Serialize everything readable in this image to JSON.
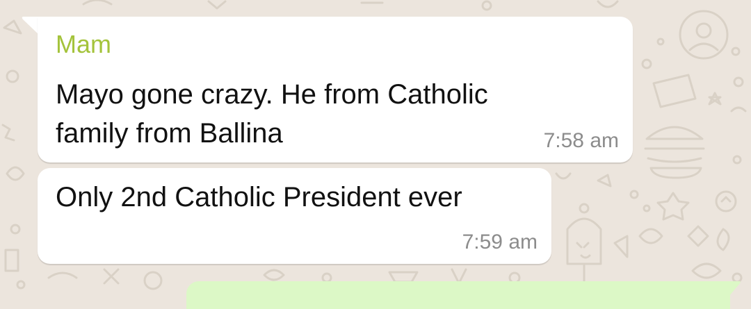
{
  "chat": {
    "messages": [
      {
        "sender": "Mam",
        "text": "Mayo gone crazy. He from Catholic\nfamily from Ballina",
        "time": "7:58 am"
      },
      {
        "text": "Only 2nd Catholic President ever",
        "time": "7:59 am"
      }
    ]
  },
  "colors": {
    "wallpaper": "#ece5dd",
    "incoming_bubble": "#ffffff",
    "outgoing_bubble": "#dcf8c6",
    "sender_name": "#a4c33b",
    "timestamp": "#8c8c8c"
  }
}
